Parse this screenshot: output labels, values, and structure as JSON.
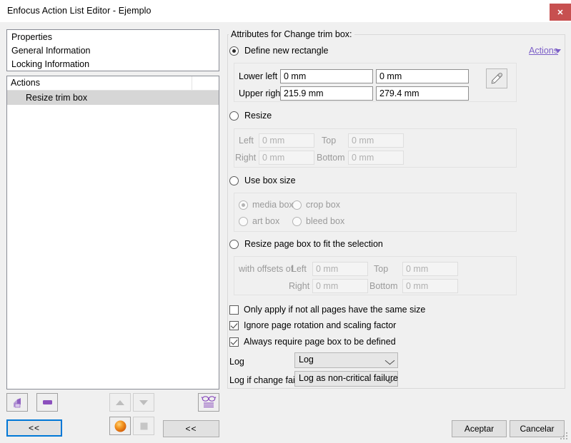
{
  "window": {
    "title": "Enfocus Action List Editor - Ejemplo",
    "close_label": "✕",
    "accent_close": "#c75050"
  },
  "left": {
    "properties": [
      {
        "label": "Properties"
      },
      {
        "label": "General Information"
      },
      {
        "label": "Locking Information"
      }
    ],
    "actions_list": {
      "header": "Actions",
      "rows": [
        {
          "label": "Resize trim box",
          "selected": true
        }
      ]
    },
    "toolbar": {
      "add_icon": "add-action-icon",
      "remove_icon": "remove-action-icon",
      "move_up_icon": "move-up-icon",
      "move_down_icon": "move-down-icon",
      "glasses_icon": "preview-glasses-icon",
      "sphere_icon": "orange-sphere-icon",
      "square_icon": "gray-square-icon",
      "collapse_left_label": "<<",
      "collapse_right_label": "<<"
    }
  },
  "attributes": {
    "group_title": "Attributes for Change trim box:",
    "actions_link": "Actions",
    "modes": [
      {
        "id": "define-new-rectangle",
        "label": "Define new rectangle",
        "selected": true,
        "enabled": true
      },
      {
        "id": "resize",
        "label": "Resize",
        "selected": false,
        "enabled": true
      },
      {
        "id": "use-box-size",
        "label": "Use box size",
        "selected": false,
        "enabled": true
      },
      {
        "id": "resize-page-box-to-fit-selection",
        "label": "Resize page box to fit the selection",
        "selected": false,
        "enabled": true
      }
    ],
    "define_rect": {
      "lower_left_label": "Lower left",
      "lower_left_x": "0 mm",
      "lower_left_y": "0 mm",
      "upper_right_label": "Upper right",
      "upper_right_x": "215.9 mm",
      "upper_right_y": "279.4 mm",
      "eyedropper_icon": "eyedropper-icon"
    },
    "resize": {
      "left_label": "Left",
      "left_value": "0 mm",
      "top_label": "Top",
      "top_value": "0 mm",
      "right_label": "Right",
      "right_value": "0 mm",
      "bottom_label": "Bottom",
      "bottom_value": "0 mm"
    },
    "box_size": {
      "options": [
        {
          "id": "media-box",
          "label": "media box",
          "selected": true
        },
        {
          "id": "crop-box",
          "label": "crop box",
          "selected": false
        },
        {
          "id": "art-box",
          "label": "art box",
          "selected": false
        },
        {
          "id": "bleed-box",
          "label": "bleed box",
          "selected": false
        }
      ]
    },
    "fit_selection": {
      "with_offsets_label": "with offsets of",
      "left_label": "Left",
      "left_value": "0 mm",
      "top_label": "Top",
      "top_value": "0 mm",
      "right_label": "Right",
      "right_value": "0 mm",
      "bottom_label": "Bottom",
      "bottom_value": "0 mm"
    },
    "checkboxes": [
      {
        "id": "only-apply-if-not-all-pages-same-size",
        "label": "Only apply if not all pages have the same size",
        "checked": false
      },
      {
        "id": "ignore-page-rotation-and-scaling-factor",
        "label": "Ignore page rotation and scaling factor",
        "checked": true
      },
      {
        "id": "always-require-page-box-to-be-defined",
        "label": "Always require page box to be defined",
        "checked": true
      }
    ],
    "log": {
      "label": "Log",
      "value": "Log"
    },
    "log_fail": {
      "label": "Log if change fails",
      "value": "Log as non-critical failure"
    }
  },
  "footer": {
    "accept_label": "Aceptar",
    "cancel_label": "Cancelar"
  }
}
